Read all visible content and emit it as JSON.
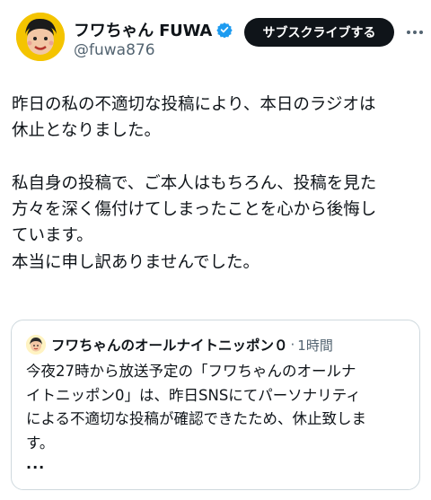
{
  "author": {
    "display_name": "フワちゃん FUWA",
    "handle": "@fuwa876",
    "subscribe_label": "サブスクライブする",
    "verified_color": "#1d9bf0",
    "avatar_color": "#f4c400"
  },
  "post": {
    "paragraphs": [
      "昨日の私の不適切な投稿により、本日のラジオは\n休止となりました。",
      "",
      "私自身の投稿で、ご本人はもちろん、投稿を見た\n方々を深く傷付けてしまったことを心から後悔し\nています。\n本当に申し訳ありませんでした。"
    ]
  },
  "quote": {
    "author_name": "フワちゃんのオールナイトニッポン０",
    "separator": "·",
    "time": "1時間",
    "text": "今夜27時から放送予定の「フワちゃんのオールナ\nイトニッポン0」は、昨日SNSにてパーソナリティ\nによる不適切な投稿が確認できたため、休止致しま\nす。",
    "ellipsis": "..."
  }
}
